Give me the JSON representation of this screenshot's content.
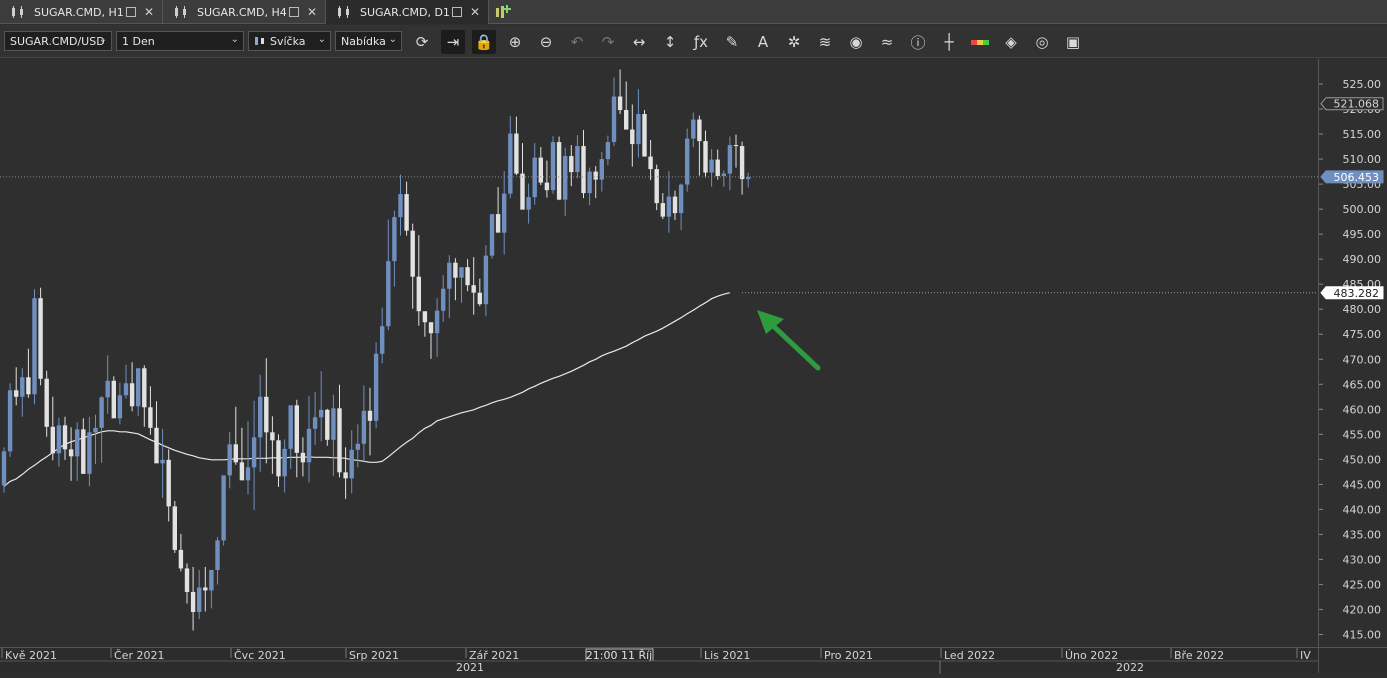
{
  "tabs": [
    {
      "label": "SUGAR.CMD, H1",
      "active": false
    },
    {
      "label": "SUGAR.CMD, H4",
      "active": false
    },
    {
      "label": "SUGAR.CMD, D1",
      "active": true
    }
  ],
  "toolbar": {
    "symbol": "SUGAR.CMD/USD",
    "timeframe": "1 Den",
    "chart_type": "Svíčka",
    "price_side": "Nabídka",
    "tools": [
      "refresh-icon",
      "auto-scroll-icon",
      "lock-icon",
      "zoom-in-icon",
      "zoom-out-icon",
      "undo-icon",
      "redo-icon",
      "horizontal-resize-icon",
      "vertical-resize-icon",
      "indicator-fx-icon",
      "pencil-draw-icon",
      "text-tool-icon",
      "crosshair-star-icon",
      "layers-icon",
      "eye-icon",
      "signal-icon",
      "info-icon",
      "crosshair-icon",
      "color-bar-icon",
      "fill-bucket-icon",
      "cycle-icon",
      "save-icon"
    ]
  },
  "colors": {
    "bull": "#6f8fbf",
    "bear": "#e2e2e2",
    "ma": "#e8e8e8",
    "arrow": "#2e9b3e",
    "bg": "#2f2f2f"
  },
  "yaxis": {
    "labels": [
      "525.00",
      "520.00",
      "515.00",
      "510.00",
      "505.00",
      "500.00",
      "495.00",
      "490.00",
      "485.00",
      "480.00",
      "475.00",
      "470.00",
      "465.00",
      "460.00",
      "455.00",
      "450.00",
      "445.00",
      "440.00",
      "435.00",
      "430.00",
      "425.00",
      "420.00",
      "415.00"
    ]
  },
  "price_markers": {
    "high": "521.068",
    "last": "506.453",
    "ma": "483.282"
  },
  "xaxis": {
    "months": [
      "Kvě 2021",
      "Čer 2021",
      "Čvc 2021",
      "Srp 2021",
      "Zář 2021",
      "Lis 2021",
      "Pro 2021",
      "Led 2022",
      "Úno 2022",
      "Bře 2022",
      "IV"
    ],
    "cursor_label": "21:00 11 Říj",
    "years": [
      "2021",
      "2022"
    ]
  },
  "chart_data": {
    "type": "candlestick",
    "symbol": "SUGAR.CMD",
    "timeframe": "D1",
    "ylim": [
      412.5,
      530
    ],
    "candles": [
      [
        444.8,
        452.4,
        443.3,
        451.6
      ],
      [
        451.6,
        465.2,
        450.5,
        463.8
      ],
      [
        463.8,
        468.4,
        460.8,
        462.5
      ],
      [
        462.5,
        468.2,
        458.5,
        466.4
      ],
      [
        466.4,
        472.1,
        462.3,
        463.0
      ],
      [
        463.0,
        484.0,
        461.0,
        482.2
      ],
      [
        482.2,
        484.3,
        464.8,
        466.1
      ],
      [
        466.1,
        467.7,
        454.5,
        456.5
      ],
      [
        456.5,
        462.5,
        449.8,
        451.2
      ],
      [
        451.2,
        458.3,
        448.5,
        456.8
      ],
      [
        456.8,
        458.5,
        449.9,
        452.0
      ],
      [
        452.0,
        456.4,
        445.7,
        450.6
      ],
      [
        450.6,
        457.4,
        445.7,
        456.0
      ],
      [
        456.0,
        458.2,
        447.6,
        447.1
      ],
      [
        447.1,
        458.5,
        444.6,
        455.4
      ],
      [
        455.4,
        458.9,
        449.1,
        456.3
      ],
      [
        456.3,
        462.6,
        449.3,
        462.4
      ],
      [
        462.4,
        470.8,
        459.1,
        465.7
      ],
      [
        465.7,
        466.6,
        458.7,
        458.2
      ],
      [
        458.2,
        465.3,
        457.0,
        462.8
      ],
      [
        462.8,
        468.9,
        462.1,
        465.2
      ],
      [
        465.2,
        469.4,
        459.6,
        460.6
      ],
      [
        460.6,
        468.2,
        458.7,
        468.2
      ],
      [
        468.2,
        468.8,
        456.5,
        460.4
      ],
      [
        460.4,
        464.6,
        454.9,
        456.3
      ],
      [
        456.3,
        461.6,
        450.0,
        449.2
      ],
      [
        449.2,
        456.1,
        442.3,
        449.9
      ],
      [
        449.9,
        452.0,
        437.6,
        440.6
      ],
      [
        440.6,
        441.7,
        431.3,
        431.9
      ],
      [
        431.9,
        435.1,
        427.6,
        428.2
      ],
      [
        428.2,
        429.2,
        421.2,
        423.5
      ],
      [
        423.5,
        428.5,
        415.8,
        419.5
      ],
      [
        419.5,
        427.9,
        418.1,
        424.4
      ],
      [
        424.4,
        428.5,
        419.6,
        423.8
      ],
      [
        423.8,
        427.5,
        420.2,
        427.9
      ],
      [
        427.9,
        434.5,
        425.0,
        433.8
      ],
      [
        433.8,
        441.6,
        432.8,
        446.8
      ],
      [
        446.8,
        455.5,
        444.2,
        453.0
      ],
      [
        453.0,
        460.5,
        448.9,
        449.4
      ],
      [
        449.4,
        456.3,
        447.4,
        445.8
      ],
      [
        445.8,
        457.6,
        443.0,
        448.4
      ],
      [
        448.4,
        461.7,
        439.9,
        454.4
      ],
      [
        454.4,
        466.9,
        447.5,
        462.5
      ],
      [
        462.5,
        470.2,
        449.2,
        455.4
      ],
      [
        455.4,
        458.6,
        447.1,
        453.8
      ],
      [
        453.8,
        455.0,
        444.5,
        446.6
      ],
      [
        446.6,
        454.0,
        443.4,
        452.1
      ],
      [
        452.1,
        460.0,
        448.1,
        460.8
      ],
      [
        460.8,
        461.9,
        446.4,
        451.3
      ],
      [
        451.3,
        454.4,
        446.6,
        449.4
      ],
      [
        449.4,
        462.6,
        445.4,
        456.1
      ],
      [
        456.1,
        463.5,
        452.9,
        458.4
      ],
      [
        458.4,
        467.6,
        453.6,
        459.9
      ],
      [
        459.9,
        460.1,
        452.7,
        453.9
      ],
      [
        453.9,
        462.9,
        446.7,
        460.2
      ],
      [
        460.2,
        464.9,
        446.4,
        447.4
      ],
      [
        447.4,
        452.4,
        442.1,
        446.2
      ],
      [
        446.2,
        455.8,
        443.2,
        451.9
      ],
      [
        451.9,
        457.0,
        448.4,
        453.1
      ],
      [
        453.1,
        464.8,
        449.6,
        459.7
      ],
      [
        459.7,
        464.3,
        450.8,
        457.7
      ],
      [
        457.7,
        473.4,
        456.2,
        471.1
      ],
      [
        471.1,
        480.3,
        469.2,
        476.6
      ],
      [
        476.6,
        497.9,
        475.8,
        489.6
      ],
      [
        489.6,
        499.7,
        484.5,
        498.4
      ],
      [
        498.4,
        506.9,
        494.7,
        503.0
      ],
      [
        503.0,
        505.5,
        494.7,
        495.7
      ],
      [
        495.7,
        497.1,
        480.1,
        486.5
      ],
      [
        486.5,
        494.8,
        476.7,
        479.6
      ],
      [
        479.6,
        479.3,
        474.5,
        477.4
      ],
      [
        477.4,
        476.5,
        470.1,
        475.2
      ],
      [
        475.2,
        482.2,
        470.5,
        479.7
      ],
      [
        479.7,
        486.8,
        477.5,
        484.1
      ],
      [
        484.1,
        490.8,
        478.2,
        489.3
      ],
      [
        489.3,
        490.2,
        481.8,
        486.3
      ],
      [
        486.3,
        488.2,
        481.3,
        488.4
      ],
      [
        488.4,
        490.0,
        483.6,
        484.8
      ],
      [
        484.8,
        490.4,
        478.9,
        483.3
      ],
      [
        483.3,
        486.1,
        480.6,
        481.0
      ],
      [
        481.0,
        492.8,
        478.6,
        490.7
      ],
      [
        490.7,
        499.0,
        490.1,
        499.0
      ],
      [
        499.0,
        504.4,
        495.6,
        495.3
      ],
      [
        495.3,
        507.6,
        490.9,
        503.1
      ],
      [
        503.1,
        518.6,
        502.2,
        515.1
      ],
      [
        515.1,
        518.5,
        506.8,
        507.1
      ],
      [
        507.1,
        513.2,
        502.0,
        499.9
      ],
      [
        499.9,
        505.1,
        497.1,
        502.4
      ],
      [
        502.4,
        513.2,
        500.9,
        510.3
      ],
      [
        510.3,
        512.4,
        504.8,
        505.3
      ],
      [
        505.3,
        509.7,
        502.3,
        503.8
      ],
      [
        503.8,
        514.6,
        503.1,
        513.4
      ],
      [
        513.4,
        514.5,
        501.8,
        501.9
      ],
      [
        501.9,
        512.3,
        498.6,
        510.6
      ],
      [
        510.6,
        512.8,
        504.6,
        507.4
      ],
      [
        507.4,
        514.8,
        506.2,
        512.6
      ],
      [
        512.6,
        515.8,
        502.2,
        503.2
      ],
      [
        503.2,
        508.3,
        500.8,
        507.5
      ],
      [
        507.5,
        508.6,
        502.2,
        505.9
      ],
      [
        505.9,
        511.4,
        503.5,
        510.0
      ],
      [
        510.0,
        514.7,
        508.8,
        513.4
      ],
      [
        513.4,
        526.3,
        512.6,
        522.5
      ],
      [
        522.5,
        527.9,
        519.0,
        519.8
      ],
      [
        519.8,
        525.5,
        516.1,
        515.9
      ],
      [
        515.9,
        520.9,
        508.5,
        513.0
      ],
      [
        513.0,
        524.0,
        510.3,
        519.0
      ],
      [
        519.0,
        519.8,
        513.2,
        510.5
      ],
      [
        510.5,
        513.8,
        505.8,
        508.0
      ],
      [
        508.0,
        508.9,
        499.8,
        501.2
      ],
      [
        501.2,
        503.2,
        498.0,
        498.5
      ],
      [
        498.5,
        507.6,
        495.3,
        502.5
      ],
      [
        502.5,
        503.7,
        497.8,
        499.2
      ],
      [
        499.2,
        505.1,
        495.8,
        504.9
      ],
      [
        504.9,
        516.1,
        503.5,
        514.1
      ],
      [
        514.1,
        519.3,
        512.4,
        517.9
      ],
      [
        517.9,
        518.7,
        506.7,
        513.6
      ],
      [
        513.6,
        515.7,
        506.3,
        507.3
      ],
      [
        507.3,
        512.0,
        504.5,
        509.9
      ],
      [
        509.9,
        511.9,
        505.9,
        506.6
      ],
      [
        506.6,
        507.7,
        504.5,
        507.1
      ],
      [
        507.1,
        514.5,
        503.8,
        512.8
      ],
      [
        512.8,
        514.9,
        508.3,
        512.6
      ],
      [
        512.6,
        513.5,
        502.9,
        506.0
      ],
      [
        506.0,
        507.3,
        504.3,
        506.4
      ]
    ],
    "ma": [
      444.6,
      445.6,
      446.1,
      447.0,
      448.0,
      448.8,
      449.7,
      450.5,
      451.4,
      452.2,
      453.0,
      453.5,
      453.9,
      454.3,
      454.7,
      455.1,
      455.5,
      455.7,
      455.7,
      455.5,
      455.5,
      455.3,
      455.1,
      454.5,
      453.9,
      453.4,
      452.8,
      452.3,
      451.8,
      451.4,
      451.0,
      450.7,
      450.3,
      450.1,
      449.9,
      449.9,
      449.9,
      450.0,
      450.1,
      450.1,
      450.1,
      450.2,
      450.2,
      450.2,
      450.3,
      450.3,
      450.3,
      450.4,
      450.4,
      450.4,
      450.5,
      450.4,
      450.4,
      450.4,
      450.3,
      450.3,
      450.2,
      449.9,
      449.8,
      449.6,
      449.4,
      449.4,
      449.6,
      450.5,
      451.5,
      452.5,
      453.4,
      454.2,
      455.3,
      456.2,
      456.8,
      457.7,
      458.1,
      458.5,
      458.9,
      459.3,
      459.6,
      459.9,
      460.4,
      460.8,
      461.3,
      461.7,
      462.0,
      462.4,
      462.9,
      463.4,
      464.1,
      464.6,
      465.2,
      465.7,
      466.2,
      466.6,
      467.1,
      467.6,
      468.2,
      468.8,
      469.5,
      470.0,
      470.7,
      471.2,
      471.6,
      472.1,
      472.6,
      473.3,
      473.9,
      474.6,
      475.1,
      475.6,
      476.2,
      476.9,
      477.6,
      478.3,
      479.1,
      479.8,
      480.6,
      481.3,
      482.1,
      482.6,
      483.0,
      483.3
    ]
  }
}
